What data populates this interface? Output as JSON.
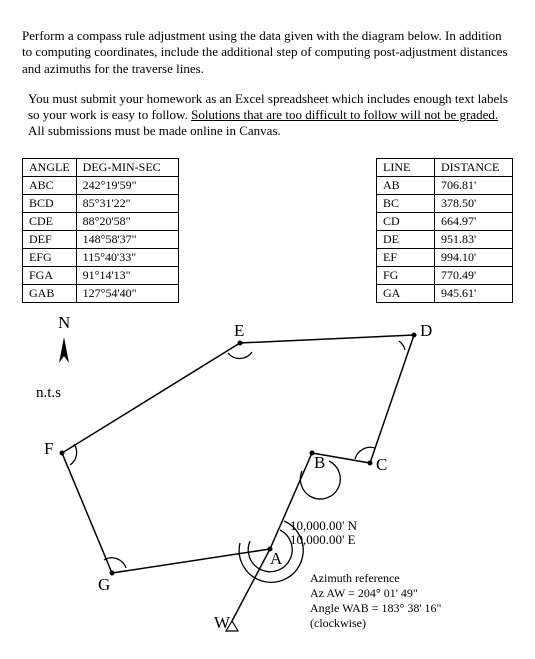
{
  "intro": {
    "p1": "Perform a compass rule adjustment using the data given with the diagram below. In addition to computing coordinates, include the additional step of computing post-adjustment distances and azimuths for the traverse lines.",
    "p2a": "You must submit your homework as an Excel spreadsheet which includes enough text labels so your work is easy to follow. ",
    "p2u": "Solutions that are too difficult to follow will not be graded.",
    "p2b": " All submissions must be made online in Canvas."
  },
  "angle_table": {
    "headers": [
      "ANGLE",
      "DEG-MIN-SEC"
    ],
    "rows": [
      [
        "ABC",
        "242°19'59\""
      ],
      [
        "BCD",
        "85°31'22\""
      ],
      [
        "CDE",
        "88°20'58\""
      ],
      [
        "DEF",
        "148°58'37\""
      ],
      [
        "EFG",
        "115°40'33\""
      ],
      [
        "FGA",
        "91°14'13\""
      ],
      [
        "GAB",
        "127°54'40\""
      ]
    ]
  },
  "distance_table": {
    "headers": [
      "LINE",
      "DISTANCE"
    ],
    "rows": [
      [
        "AB",
        "706.81'"
      ],
      [
        "BC",
        "378.50'"
      ],
      [
        "CD",
        "664.97'"
      ],
      [
        "DE",
        "951.83'"
      ],
      [
        "EF",
        "994.10'"
      ],
      [
        "FG",
        "770.49'"
      ],
      [
        "GA",
        "945.61'"
      ]
    ]
  },
  "diagram": {
    "north": "N",
    "nts": "n.t.s",
    "points": {
      "A": "A",
      "B": "B",
      "C": "C",
      "D": "D",
      "E": "E",
      "F": "F",
      "G": "G",
      "W": "W"
    },
    "coords_n": "10,000.00' N",
    "coords_e": "10,000.00' E",
    "az_title": "Azimuth reference",
    "az_aw": "Az AW = 204° 01' 49\"",
    "angle_wab": "Angle WAB = 183° 38' 16\"",
    "clockwise": "(clockwise)"
  },
  "chart_data": {
    "type": "table",
    "title": "Traverse compass-rule adjustment input data",
    "angles": [
      {
        "angle": "ABC",
        "dms": "242°19'59\""
      },
      {
        "angle": "BCD",
        "dms": "85°31'22\""
      },
      {
        "angle": "CDE",
        "dms": "88°20'58\""
      },
      {
        "angle": "DEF",
        "dms": "148°58'37\""
      },
      {
        "angle": "EFG",
        "dms": "115°40'33\""
      },
      {
        "angle": "FGA",
        "dms": "91°14'13\""
      },
      {
        "angle": "GAB",
        "dms": "127°54'40\""
      }
    ],
    "lines": [
      {
        "line": "AB",
        "distance_ft": 706.81
      },
      {
        "line": "BC",
        "distance_ft": 378.5
      },
      {
        "line": "CD",
        "distance_ft": 664.97
      },
      {
        "line": "DE",
        "distance_ft": 951.83
      },
      {
        "line": "EF",
        "distance_ft": 994.1
      },
      {
        "line": "FG",
        "distance_ft": 770.49
      },
      {
        "line": "GA",
        "distance_ft": 945.61
      }
    ],
    "start_point": {
      "name": "A",
      "northing": 10000.0,
      "easting": 10000.0
    },
    "azimuth_reference": {
      "az_aw_dms": "204°01'49\"",
      "angle_wab_dms": "183°38'16\"",
      "direction": "clockwise"
    },
    "vertices": [
      "A",
      "B",
      "C",
      "D",
      "E",
      "F",
      "G"
    ]
  }
}
